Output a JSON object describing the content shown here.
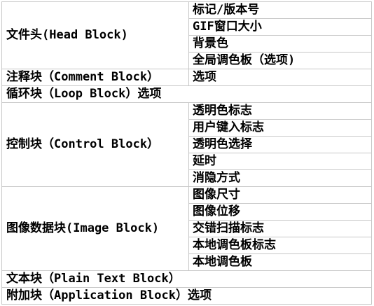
{
  "table": {
    "head_block": {
      "label": "文件头(Head Block)",
      "items": [
        "标记/版本号",
        "GIF窗口大小",
        "背景色",
        "全局调色板（选项)"
      ]
    },
    "comment_block": {
      "label": "注释块（Comment Block）",
      "value": "选项"
    },
    "loop_block": {
      "label": "循环块（Loop Block）选项"
    },
    "control_block": {
      "label": "控制块（Control Block）",
      "items": [
        "透明色标志",
        "用户键入标志",
        "透明色选择",
        "延时",
        "消隐方式"
      ]
    },
    "image_block": {
      "label": "图像数据块(Image Block)",
      "items": [
        "图像尺寸",
        "图像位移",
        "交错扫描标志",
        "本地调色板标志",
        "本地调色板"
      ]
    },
    "text_block": {
      "label": "文本块（Plain Text Block）"
    },
    "application_block": {
      "label": "附加块（Application Block）选项"
    }
  }
}
